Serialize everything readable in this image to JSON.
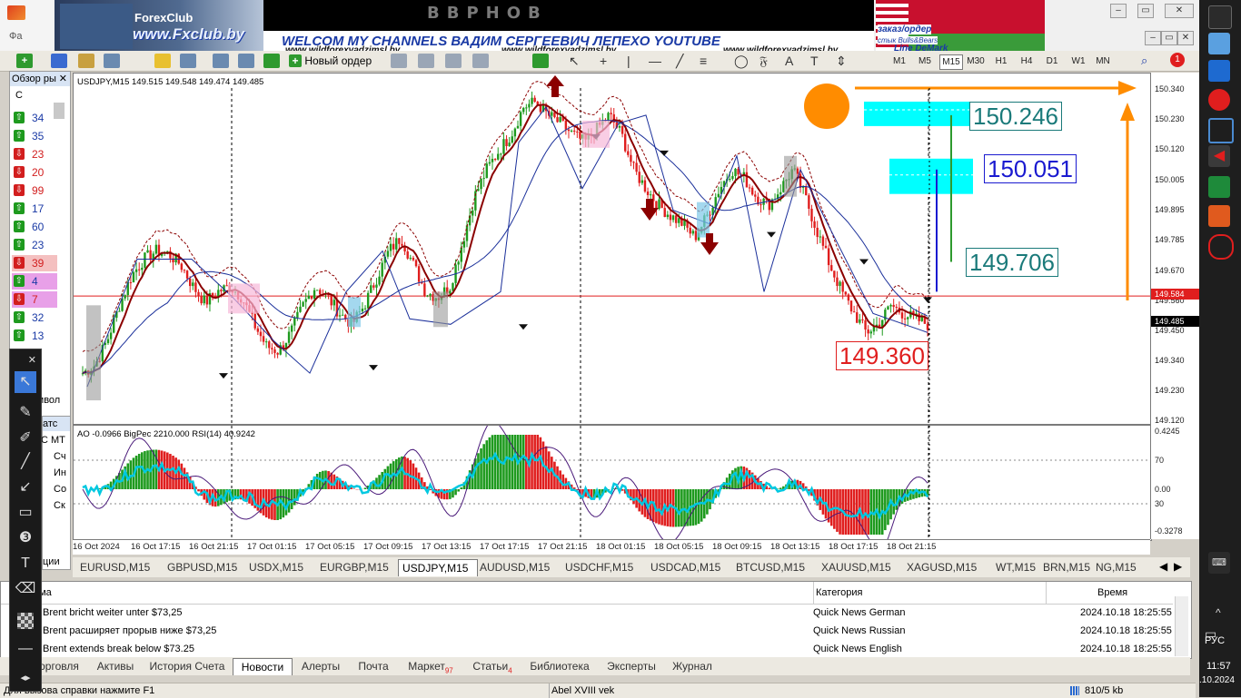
{
  "banner": {
    "brand_top": "ForexClub",
    "brand_url": "www.Fxclub.by",
    "channel_text": "WELCOM MY CHANNELS ВАДИМ СЕРГЕЕВИЧ ЛЕПЕХО YOUTUBE",
    "site_1": "www.wildforexvadzimsl.by",
    "site_2": "www.wildforexvadzimsl.by",
    "site_3": "www.wildforexvadzimsl.by",
    "order_text": "заказ/ордер",
    "stack_text": "стык Bulls&Bears",
    "line_text": "Line DeMark"
  },
  "window_controls": {
    "minimize": "–",
    "restore": "▭",
    "close": "✕"
  },
  "toolbar": {
    "new_order_label": "Новый ордер",
    "timeframes": [
      "M1",
      "M5",
      "M15",
      "M30",
      "H1",
      "H4",
      "D1",
      "W1",
      "MN"
    ],
    "active_timeframe": "M15",
    "notification_count": "1"
  },
  "market_watch": {
    "title": "Обзор ры",
    "col_header": "С",
    "rows": [
      {
        "dir": "up",
        "value": "34"
      },
      {
        "dir": "up",
        "value": "35"
      },
      {
        "dir": "dn",
        "value": "23"
      },
      {
        "dir": "dn",
        "value": "20"
      },
      {
        "dir": "dn",
        "value": "99"
      },
      {
        "dir": "up",
        "value": "17"
      },
      {
        "dir": "up",
        "value": "60"
      },
      {
        "dir": "up",
        "value": "23"
      },
      {
        "dir": "dn",
        "value": "39"
      },
      {
        "dir": "up",
        "value": "4"
      },
      {
        "dir": "dn",
        "value": "7"
      },
      {
        "dir": "up",
        "value": "32"
      },
      {
        "dir": "up",
        "value": "13"
      }
    ],
    "tab_symbols": "символ"
  },
  "navigator": {
    "title": "атс",
    "items": [
      "С МТ",
      "Сч",
      "Ин",
      "Со",
      "Ск"
    ],
    "bottom": "ции"
  },
  "chart": {
    "header": "USDJPY,M15  149.515 149.548 149.474 149.485",
    "indicator_header": "AO -0.0966  BigPec 2210.000  RSI(14) 40.9242",
    "current_price_red": "149.584",
    "current_price_black": "149.485",
    "callouts": {
      "top": "150.246",
      "mid": "150.051",
      "low_teal": "149.706",
      "red": "149.360"
    }
  },
  "chart_data": {
    "type": "candlestick",
    "title": "USDJPY,M15",
    "price_axis": [
      "150.340",
      "150.230",
      "150.120",
      "150.005",
      "149.895",
      "149.785",
      "149.670",
      "149.560",
      "149.450",
      "149.340",
      "149.230",
      "149.120"
    ],
    "indicator_axis": [
      "0.4245",
      "70",
      "0.00",
      "30",
      "-0.3278"
    ],
    "x_labels": [
      "16 Oct 2024",
      "16 Oct 17:15",
      "16 Oct 21:15",
      "17 Oct 01:15",
      "17 Oct 05:15",
      "17 Oct 09:15",
      "17 Oct 13:15",
      "17 Oct 17:15",
      "17 Oct 21:15",
      "18 Oct 01:15",
      "18 Oct 05:15",
      "18 Oct 09:15",
      "18 Oct 13:15",
      "18 Oct 17:15",
      "18 Oct 21:15"
    ],
    "ylim": [
      149.12,
      150.36
    ],
    "close_path": [
      149.3,
      149.33,
      149.42,
      149.55,
      149.66,
      149.72,
      149.75,
      149.74,
      149.7,
      149.62,
      149.56,
      149.6,
      149.62,
      149.58,
      149.48,
      149.4,
      149.38,
      149.45,
      149.55,
      149.62,
      149.58,
      149.52,
      149.48,
      149.55,
      149.65,
      149.75,
      149.8,
      149.7,
      149.6,
      149.58,
      149.62,
      149.78,
      149.95,
      150.05,
      150.12,
      150.18,
      150.28,
      150.3,
      150.25,
      150.22,
      150.18,
      150.15,
      150.2,
      150.25,
      150.18,
      150.05,
      149.98,
      149.92,
      149.88,
      149.85,
      149.8,
      149.88,
      149.98,
      150.05,
      150.02,
      149.95,
      149.92,
      149.98,
      150.05,
      149.95,
      149.82,
      149.7,
      149.6,
      149.52,
      149.45,
      149.48,
      149.55,
      149.52,
      149.5,
      149.48
    ]
  },
  "symbol_tabs": [
    "EURUSD,M15",
    "GBPUSD,M15",
    "USDX,M15",
    "EURGBP,M15",
    "USDJPY,M15",
    "AUDUSD,M15",
    "USDCHF,M15",
    "USDCAD,M15",
    "BTCUSD,M15",
    "XAUUSD,M15",
    "XAGUSD,M15",
    "WT,M15",
    "BRN,M15",
    "NG,M15"
  ],
  "active_symbol_tab": "USDJPY,M15",
  "terminal": {
    "col_headline": "ема",
    "col_category": "Категория",
    "col_time": "Время",
    "rows": [
      {
        "headline": "Brent bricht weiter unter $73,25",
        "category": "Quick News German",
        "time": "2024.10.18 18:25:55"
      },
      {
        "headline": "Brent расширяет прорыв ниже $73,25",
        "category": "Quick News Russian",
        "time": "2024.10.18 18:25:55"
      },
      {
        "headline": "Brent extends break below $73.25",
        "category": "Quick News English",
        "time": "2024.10.18 18:25:55"
      }
    ],
    "tabs": [
      "орговля",
      "Активы",
      "История Счета",
      "Новости",
      "Алерты",
      "Почта",
      "Маркет",
      "Статьи",
      "Библиотека",
      "Эксперты",
      "Журнал"
    ],
    "tab_badges": {
      "Маркет": "97",
      "Статьи": "4"
    },
    "active_tab": "Новости"
  },
  "status": {
    "help": "Для вызова справки нажмите F1",
    "profile": "Abel XVIII vek",
    "traffic": "810/5 kb"
  },
  "taskbar": {
    "lang": "РУС",
    "time": "11:57",
    "date": ".10.2024"
  },
  "colors": {
    "bull": "#1e9a1e",
    "bear": "#e01e1e",
    "ma_dark": "#8b0000",
    "ma_blue": "#1a2f9a",
    "rsi": "#00c8e0",
    "cyan": "#00ffff",
    "orange": "#ff8c00"
  }
}
